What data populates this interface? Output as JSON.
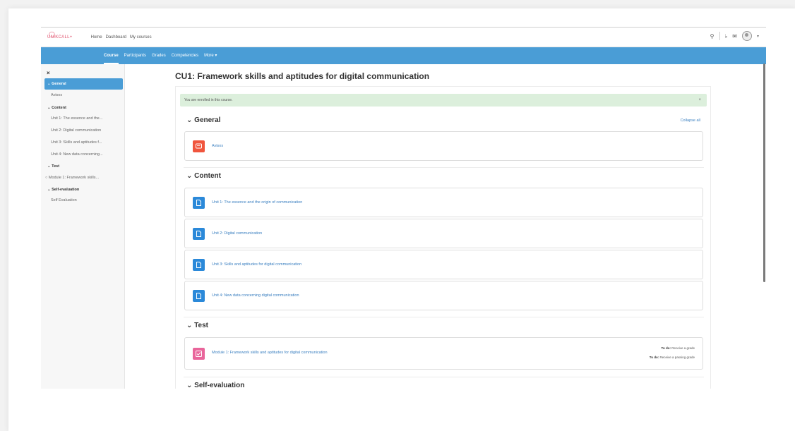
{
  "topnav": {
    "logo_text": "UNIKCALL+",
    "links": [
      "Home",
      "Dashboard",
      "My courses"
    ]
  },
  "secnav": {
    "items": [
      "Course",
      "Participants",
      "Grades",
      "Competencies",
      "More ▾"
    ]
  },
  "drawer": {
    "close": "×",
    "sections": [
      {
        "title": "General",
        "items": [
          "Avisos"
        ]
      },
      {
        "title": "Content",
        "items": [
          "Unit 1: The essence and the...",
          "Unit 2: Digital communication",
          "Unit 3: Skills and aptitudes f...",
          "Unit 4: New data concerning..."
        ]
      },
      {
        "title": "Test",
        "items": [
          "Module 1: Framework skills..."
        ]
      },
      {
        "title": "Self-evaluation",
        "items": [
          "Self Evaluation"
        ]
      }
    ]
  },
  "page": {
    "title": "CU1: Framework skills and aptitudes for digital communication",
    "notice": "You are enrolled in this course.",
    "notice_close": "×",
    "collapse_all": "Collapse all"
  },
  "sections": {
    "general": {
      "title": "General",
      "activities": [
        {
          "name": "Avisos",
          "icon": "forum-icon",
          "color": "#f0553d"
        }
      ]
    },
    "content": {
      "title": "Content",
      "activities": [
        {
          "name": "Unit 1: The essence and the origin of communication",
          "icon": "page-icon",
          "color": "#2b89d9"
        },
        {
          "name": "Unit 2: Digital communication",
          "icon": "page-icon",
          "color": "#2b89d9"
        },
        {
          "name": "Unit 3: Skills and aptitudes for digital communication",
          "icon": "page-icon",
          "color": "#2b89d9"
        },
        {
          "name": "Unit 4: New data concerning digital communication",
          "icon": "page-icon",
          "color": "#2b89d9"
        }
      ]
    },
    "test": {
      "title": "Test",
      "activities": [
        {
          "name": "Module 1: Framework skills and aptitudes for digital communication",
          "icon": "quiz-icon",
          "color": "#e9659b",
          "todo": [
            {
              "label": "To do:",
              "text": "Receive a grade"
            },
            {
              "label": "To do:",
              "text": "Receive a passing grade"
            }
          ]
        }
      ]
    },
    "self_evaluation": {
      "title": "Self-evaluation"
    }
  },
  "colors": {
    "brand": "#4a9dd6",
    "notice_bg": "#dcefdc",
    "link": "#3a7fc0"
  }
}
